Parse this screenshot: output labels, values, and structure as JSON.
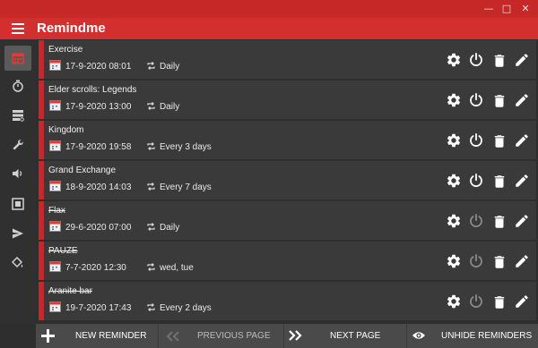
{
  "window": {
    "minimize_glyph": "—",
    "maximize_glyph": "□",
    "close_glyph": "✕"
  },
  "app": {
    "title": "Remindme",
    "accent": "#c62828"
  },
  "sidebar": {
    "items": [
      {
        "icon": "calendar-icon",
        "active": true
      },
      {
        "icon": "timer-icon",
        "active": false
      },
      {
        "icon": "storage-icon",
        "active": false
      },
      {
        "icon": "wrench-icon",
        "active": false
      },
      {
        "icon": "volume-icon",
        "active": false
      },
      {
        "icon": "screen-capture-icon",
        "active": false
      },
      {
        "icon": "send-icon",
        "active": false
      },
      {
        "icon": "theme-icon",
        "active": false
      }
    ]
  },
  "reminders": [
    {
      "name": "Exercise",
      "date": "17-9-2020 08:01",
      "repeat": "Daily",
      "enabled": true
    },
    {
      "name": "Elder scrolls: Legends",
      "date": "17-9-2020 13:00",
      "repeat": "Daily",
      "enabled": true
    },
    {
      "name": "Kingdom",
      "date": "17-9-2020 19:58",
      "repeat": "Every 3 days",
      "enabled": true
    },
    {
      "name": "Grand Exchange",
      "date": "18-9-2020 14:03",
      "repeat": "Every 7 days",
      "enabled": true
    },
    {
      "name": "Flax",
      "date": "29-6-2020 07:00",
      "repeat": "Daily",
      "enabled": false
    },
    {
      "name": "PAUZE",
      "date": "7-7-2020 12:30",
      "repeat": "wed, tue",
      "enabled": false
    },
    {
      "name": "Aranite bar",
      "date": "19-7-2020 17:43",
      "repeat": "Every 2 days",
      "enabled": false
    }
  ],
  "bottom": {
    "new_reminder": "NEW REMINDER",
    "previous_page": "PREVIOUS PAGE",
    "next_page": "NEXT PAGE",
    "unhide_reminders": "UNHIDE REMINDERS"
  }
}
